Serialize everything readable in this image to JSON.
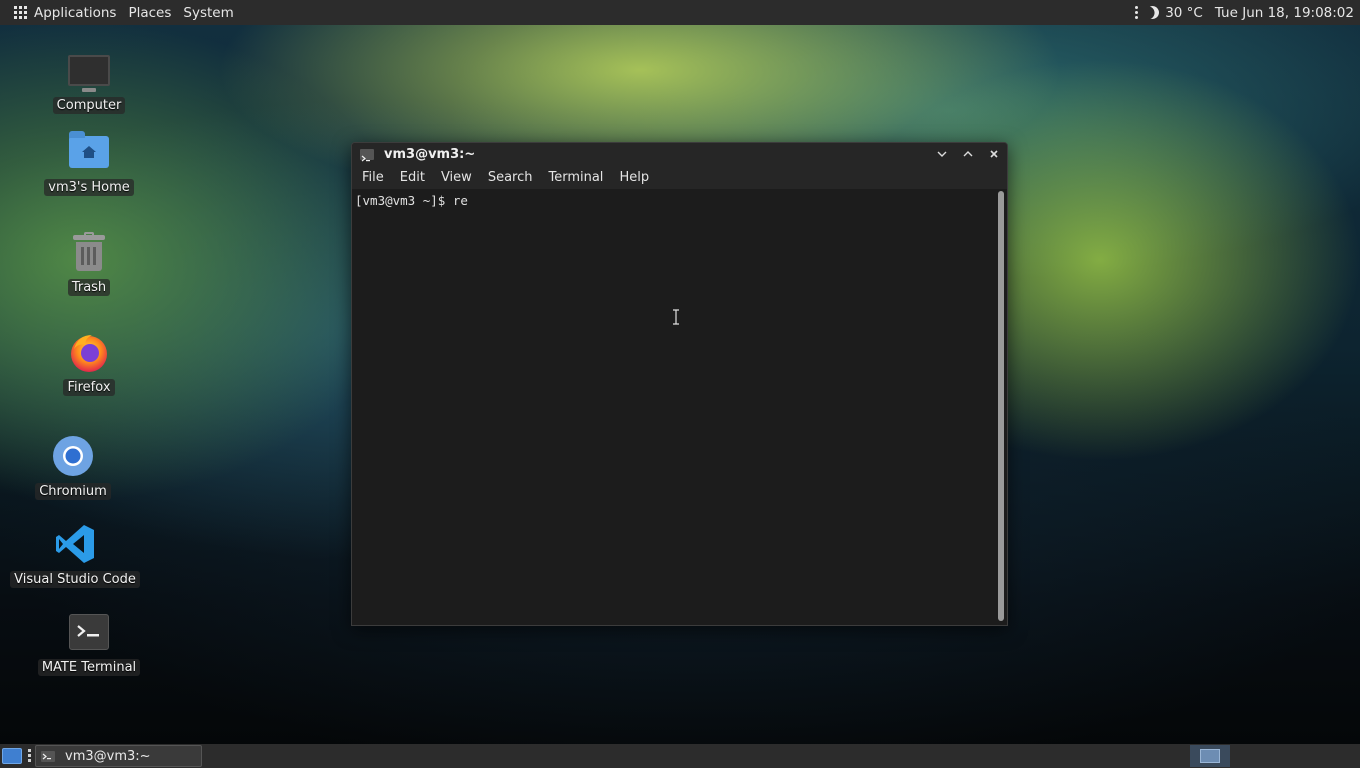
{
  "top_panel": {
    "menus": [
      "Applications",
      "Places",
      "System"
    ],
    "weather": "30 °C",
    "clock": "Tue Jun 18, 19:08:02"
  },
  "desktop_icons": [
    {
      "label": "Computer",
      "icon": "computer-icon"
    },
    {
      "label": "vm3's Home",
      "icon": "home-folder-icon"
    },
    {
      "label": "Trash",
      "icon": "trash-icon"
    },
    {
      "label": "Firefox",
      "icon": "firefox-icon"
    },
    {
      "label": "Chromium",
      "icon": "chromium-icon"
    },
    {
      "label": "Visual Studio Code",
      "icon": "vscode-icon"
    },
    {
      "label": "MATE Terminal",
      "icon": "terminal-icon"
    }
  ],
  "terminal_window": {
    "title": "vm3@vm3:~",
    "menus": [
      "File",
      "Edit",
      "View",
      "Search",
      "Terminal",
      "Help"
    ],
    "content": "[vm3@vm3 ~]$ re"
  },
  "taskbar": {
    "task_label": "vm3@vm3:~"
  },
  "colors": {
    "panel": "#2c2c2c",
    "terminal_bg": "#1c1c1c",
    "accent": "#3f7fd0"
  }
}
